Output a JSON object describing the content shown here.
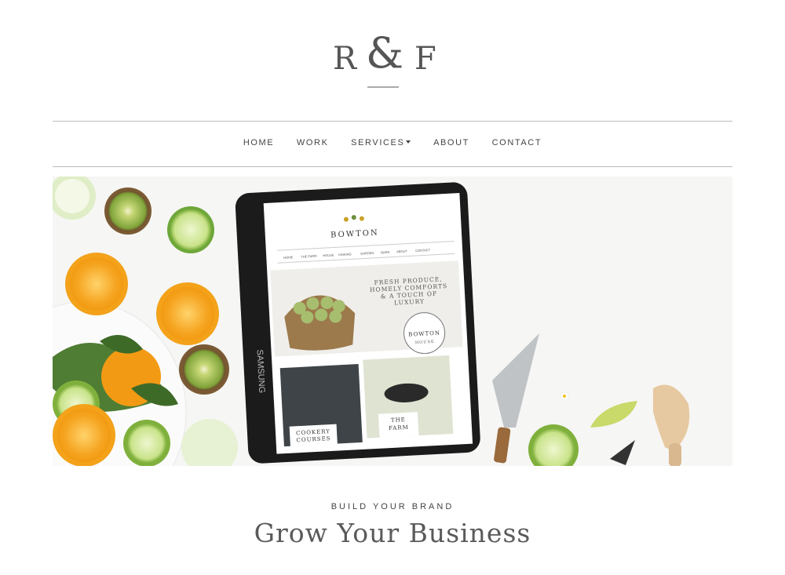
{
  "logo": {
    "left": "R",
    "amp": "&",
    "right": "F"
  },
  "nav": {
    "items": [
      {
        "label": "HOME"
      },
      {
        "label": "WORK"
      },
      {
        "label": "SERVICES"
      },
      {
        "label": "ABOUT"
      },
      {
        "label": "CONTACT"
      }
    ]
  },
  "hero": {
    "tablet_brand": "SAMSUNG",
    "site_logo": "BOWTON",
    "site_nav": [
      "HOME",
      "THE FARM",
      "HOUSE",
      "KINKING",
      "GARDEN",
      "BARN",
      "ABOUT",
      "CONTACT"
    ],
    "site_tagline": [
      "FRESH PRODUCE,",
      "HOMELY COMFORTS",
      "& A TOUCH OF",
      "LUXURY"
    ],
    "badge_line1": "BOWTON",
    "badge_line2": "HOUSE",
    "card1": [
      "COOKERY",
      "COURSES"
    ],
    "card2": [
      "THE",
      "FARM"
    ]
  },
  "section": {
    "kicker": "BUILD YOUR BRAND",
    "headline": "Grow Your Business"
  },
  "colors": {
    "text": "#444444",
    "rule": "#bbbbbb",
    "background": "#ffffff"
  }
}
